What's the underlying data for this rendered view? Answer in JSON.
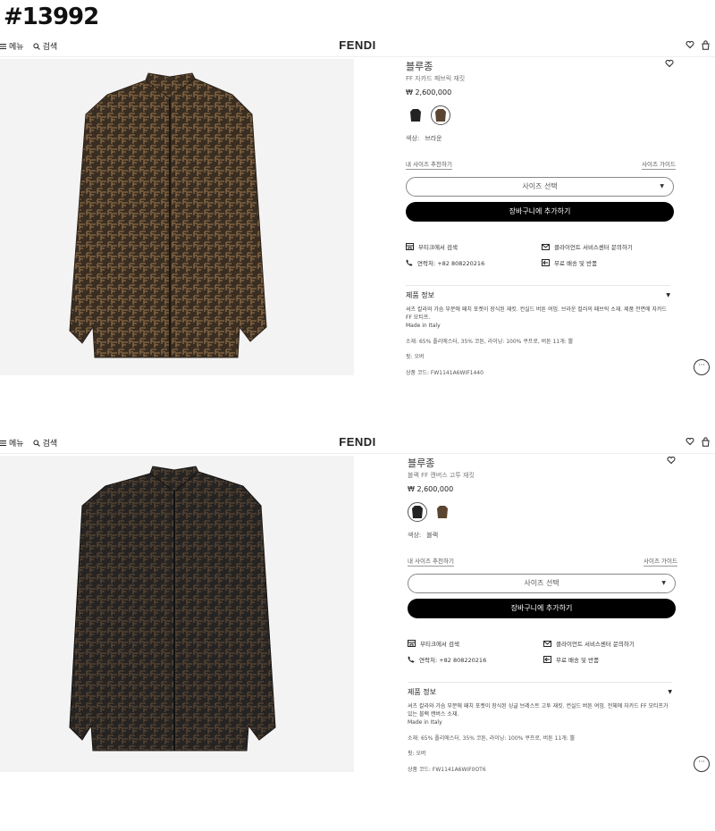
{
  "post_id": "#13992",
  "screens": [
    {
      "nav": {
        "menu": "메뉴",
        "search": "검색",
        "brand": "FENDI"
      },
      "product": {
        "title": "블루종",
        "subtitle": "FF 자카드 패브릭 재킷",
        "price": "₩ 2,600,000",
        "color_label": "색상:",
        "color_value": "브라운",
        "size_rec": "내 사이즈 추천하기",
        "size_guide": "사이즈 가이드",
        "size_select": "사이즈 선택",
        "add_to_cart": "장바구니에 추가하기",
        "boutique_search": "부티크에서 검색",
        "contact": "연락처: +82 808220216",
        "client_service": "클라이언트 서비스센터 문의하기",
        "shipping": "무료 배송 및 반품",
        "info_header": "제품 정보",
        "description": "셔츠 칼라와 가슴 부분에 패치 포켓이 장식된 재킷. 컨실드 버튼 여밈. 브라운 컬러의 패브릭 소재. 제품 전면에 자카드 FF 모티프.",
        "made_in": "Made in Italy",
        "material": "소재: 65% 폴리에스터, 35% 코튼, 라이닝: 100% 쿠프로, 버튼 11개: 뿔",
        "fit": "핏: 오버",
        "code": "상품 코드: FW1141A6WIF1440"
      },
      "shirt_color": "#3a2e22",
      "pattern_color": "#8a6a46"
    },
    {
      "nav": {
        "menu": "메뉴",
        "search": "검색",
        "brand": "FENDI"
      },
      "product": {
        "title": "블루종",
        "subtitle": "블랙 FF 캔버스 고투 재킷",
        "price": "₩ 2,600,000",
        "color_label": "색상:",
        "color_value": "블랙",
        "size_rec": "내 사이즈 추천하기",
        "size_guide": "사이즈 가이드",
        "size_select": "사이즈 선택",
        "add_to_cart": "장바구니에 추가하기",
        "boutique_search": "부티크에서 검색",
        "contact": "연락처: +82 808220216",
        "client_service": "클라이언트 서비스센터 문의하기",
        "shipping": "무료 배송 및 반품",
        "info_header": "제품 정보",
        "description": "셔츠 칼라와 가슴 부분에 패치 포켓이 장식된 싱글 브레스트 고투 재킷. 컨실드 버튼 여밈. 전체에 자카드 FF 모티프가 있는 블랙 캔버스 소재.",
        "made_in": "Made in Italy",
        "material": "소재: 65% 폴리에스터, 35% 코튼, 라이닝: 100% 쿠프로, 버튼 11개: 뿔",
        "fit": "핏: 오버",
        "code": "상품 코드: FW1141A6WIF0OT6"
      },
      "shirt_color": "#262422",
      "pattern_color": "#5a4634"
    }
  ]
}
